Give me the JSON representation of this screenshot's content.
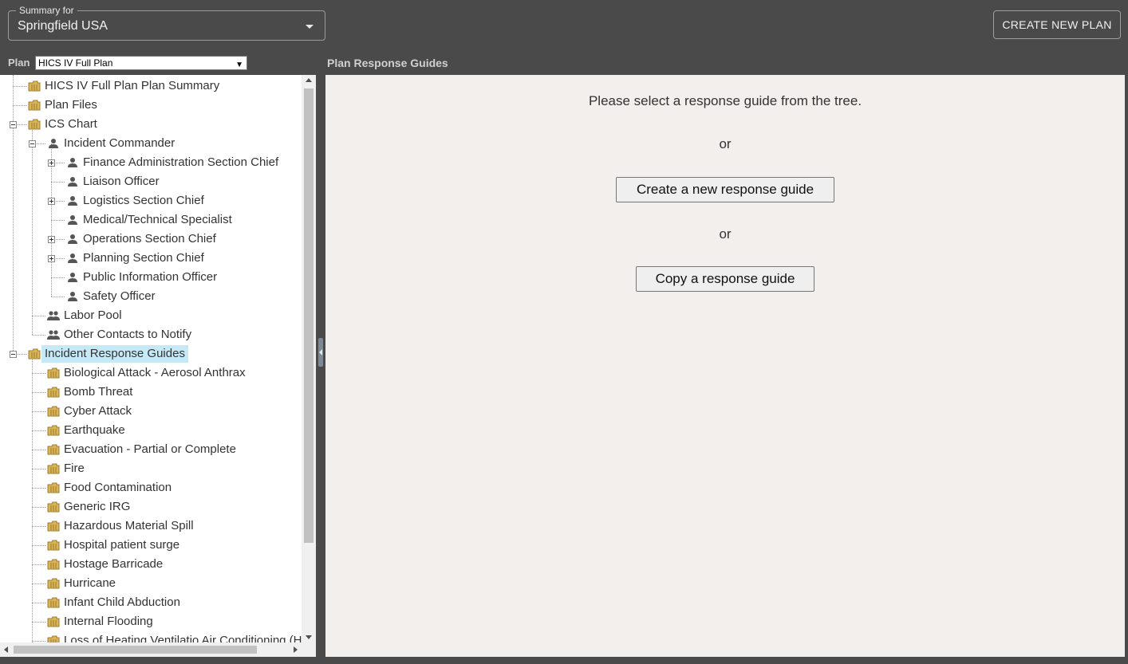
{
  "summary": {
    "legend": "Summary for",
    "value": "Springfield USA"
  },
  "header": {
    "create_plan_label": "CREATE NEW PLAN"
  },
  "plan_selector": {
    "label": "Plan",
    "selected": "HICS IV Full Plan"
  },
  "main": {
    "title": "Plan Response Guides",
    "prompt": "Please select a response guide from the tree.",
    "or1": "or",
    "create_guide_label": "Create a new response guide",
    "or2": "or",
    "copy_guide_label": "Copy a response guide"
  },
  "tree": {
    "items": [
      {
        "label": "HICS IV Full Plan Plan Summary",
        "icon": "folder-icon"
      },
      {
        "label": "Plan Files",
        "icon": "folder-icon"
      },
      {
        "label": "ICS Chart",
        "icon": "folder-icon",
        "expanded": true
      },
      {
        "label": "Incident Commander",
        "icon": "person-icon",
        "expanded": true
      },
      {
        "label": "Finance Administration Section Chief",
        "icon": "person-icon",
        "expanded": false
      },
      {
        "label": "Liaison Officer",
        "icon": "person-icon"
      },
      {
        "label": "Logistics Section Chief",
        "icon": "person-icon",
        "expanded": false
      },
      {
        "label": "Medical/Technical Specialist",
        "icon": "person-icon"
      },
      {
        "label": "Operations Section Chief",
        "icon": "person-icon",
        "expanded": false
      },
      {
        "label": "Planning Section Chief",
        "icon": "person-icon",
        "expanded": false
      },
      {
        "label": "Public Information Officer",
        "icon": "person-icon"
      },
      {
        "label": "Safety Officer",
        "icon": "person-icon"
      },
      {
        "label": "Labor Pool",
        "icon": "group-icon"
      },
      {
        "label": "Other Contacts to Notify",
        "icon": "group-icon"
      },
      {
        "label": "Incident Response Guides",
        "icon": "folder-icon",
        "expanded": true,
        "selected": true
      },
      {
        "label": "Biological Attack - Aerosol Anthrax",
        "icon": "folder-icon"
      },
      {
        "label": "Bomb Threat",
        "icon": "folder-icon"
      },
      {
        "label": "Cyber Attack",
        "icon": "folder-icon"
      },
      {
        "label": "Earthquake",
        "icon": "folder-icon"
      },
      {
        "label": "Evacuation - Partial or Complete",
        "icon": "folder-icon"
      },
      {
        "label": "Fire",
        "icon": "folder-icon"
      },
      {
        "label": "Food Contamination",
        "icon": "folder-icon"
      },
      {
        "label": "Generic IRG",
        "icon": "folder-icon"
      },
      {
        "label": "Hazardous Material Spill",
        "icon": "folder-icon"
      },
      {
        "label": "Hospital patient surge",
        "icon": "folder-icon"
      },
      {
        "label": "Hostage Barricade",
        "icon": "folder-icon"
      },
      {
        "label": "Hurricane",
        "icon": "folder-icon"
      },
      {
        "label": "Infant Child Abduction",
        "icon": "folder-icon"
      },
      {
        "label": "Internal Flooding",
        "icon": "folder-icon"
      },
      {
        "label": "Loss of Heating Ventilatio Air Conditioning (H",
        "icon": "folder-icon"
      }
    ]
  },
  "colors": {
    "chrome": "#4a4a4a",
    "main_background": "#f2efec",
    "selection": "#c6e9f7",
    "folder": "#d9b45a"
  }
}
